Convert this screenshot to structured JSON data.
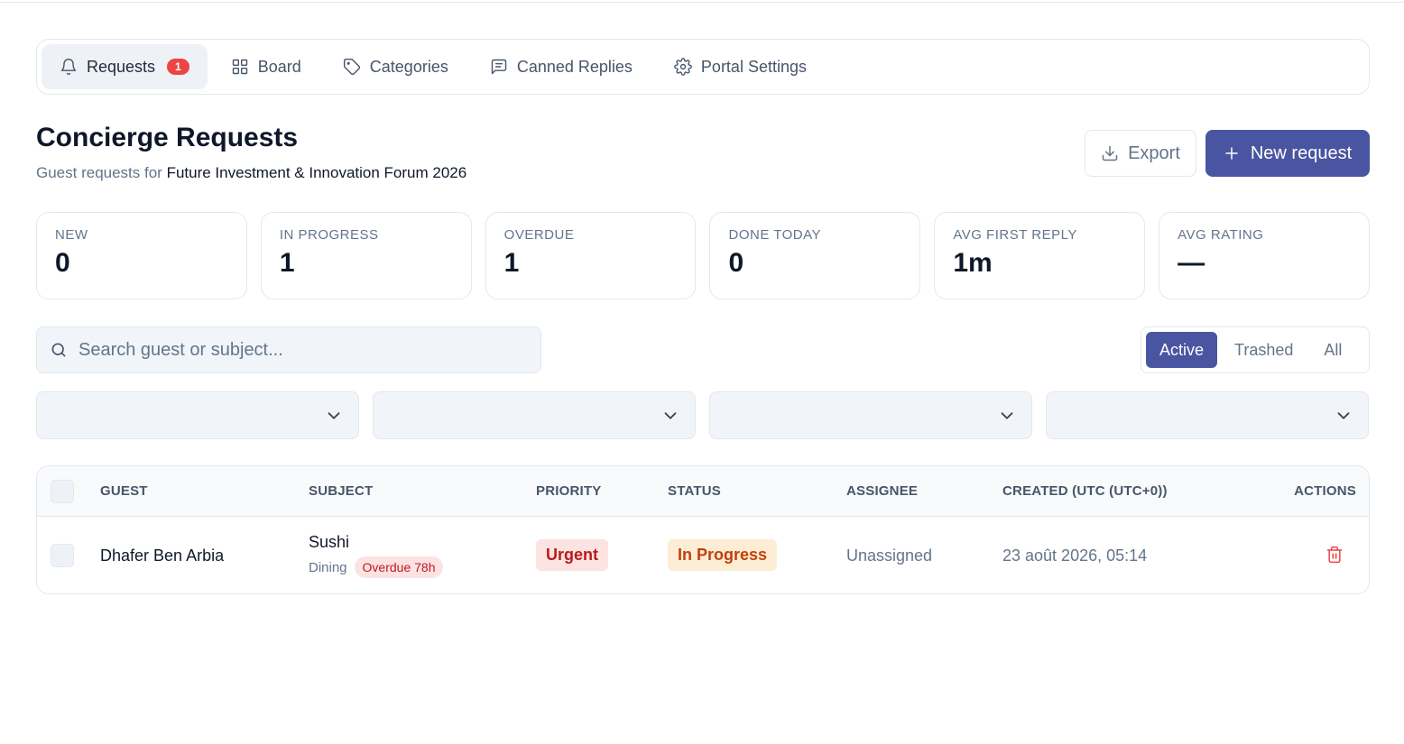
{
  "tabs": [
    {
      "label": "Requests",
      "badge": "1",
      "icon": "bell-icon",
      "active": true
    },
    {
      "label": "Board",
      "icon": "grid-icon"
    },
    {
      "label": "Categories",
      "icon": "tag-icon"
    },
    {
      "label": "Canned Replies",
      "icon": "message-icon"
    },
    {
      "label": "Portal Settings",
      "icon": "gear-icon"
    }
  ],
  "header": {
    "title": "Concierge Requests",
    "subtitle_prefix": "Guest requests for",
    "event_name": "Future Investment & Innovation Forum 2026",
    "export_label": "Export",
    "new_label": "New request"
  },
  "stats": [
    {
      "label": "NEW",
      "value": "0"
    },
    {
      "label": "IN PROGRESS",
      "value": "1"
    },
    {
      "label": "OVERDUE",
      "value": "1"
    },
    {
      "label": "DONE TODAY",
      "value": "0"
    },
    {
      "label": "AVG FIRST REPLY",
      "value": "1m"
    },
    {
      "label": "AVG RATING",
      "value": "—"
    }
  ],
  "search": {
    "placeholder": "Search guest or subject...",
    "value": ""
  },
  "view_filter": {
    "options": [
      "Active",
      "Trashed",
      "All"
    ],
    "selected": "Active"
  },
  "table": {
    "columns": [
      "GUEST",
      "SUBJECT",
      "PRIORITY",
      "STATUS",
      "ASSIGNEE",
      "CREATED (UTC (UTC+0))",
      "ACTIONS"
    ],
    "rows": [
      {
        "guest": "Dhafer Ben Arbia",
        "subject": "Sushi",
        "category": "Dining",
        "overdue": "Overdue 78h",
        "priority": "Urgent",
        "status": "In Progress",
        "assignee": "Unassigned",
        "created": "23 août 2026, 05:14"
      }
    ]
  },
  "colors": {
    "accent": "#4a55a2",
    "danger": "#ef4444",
    "urgent_bg": "#fde2e2",
    "progress_bg": "#fdedd5"
  }
}
